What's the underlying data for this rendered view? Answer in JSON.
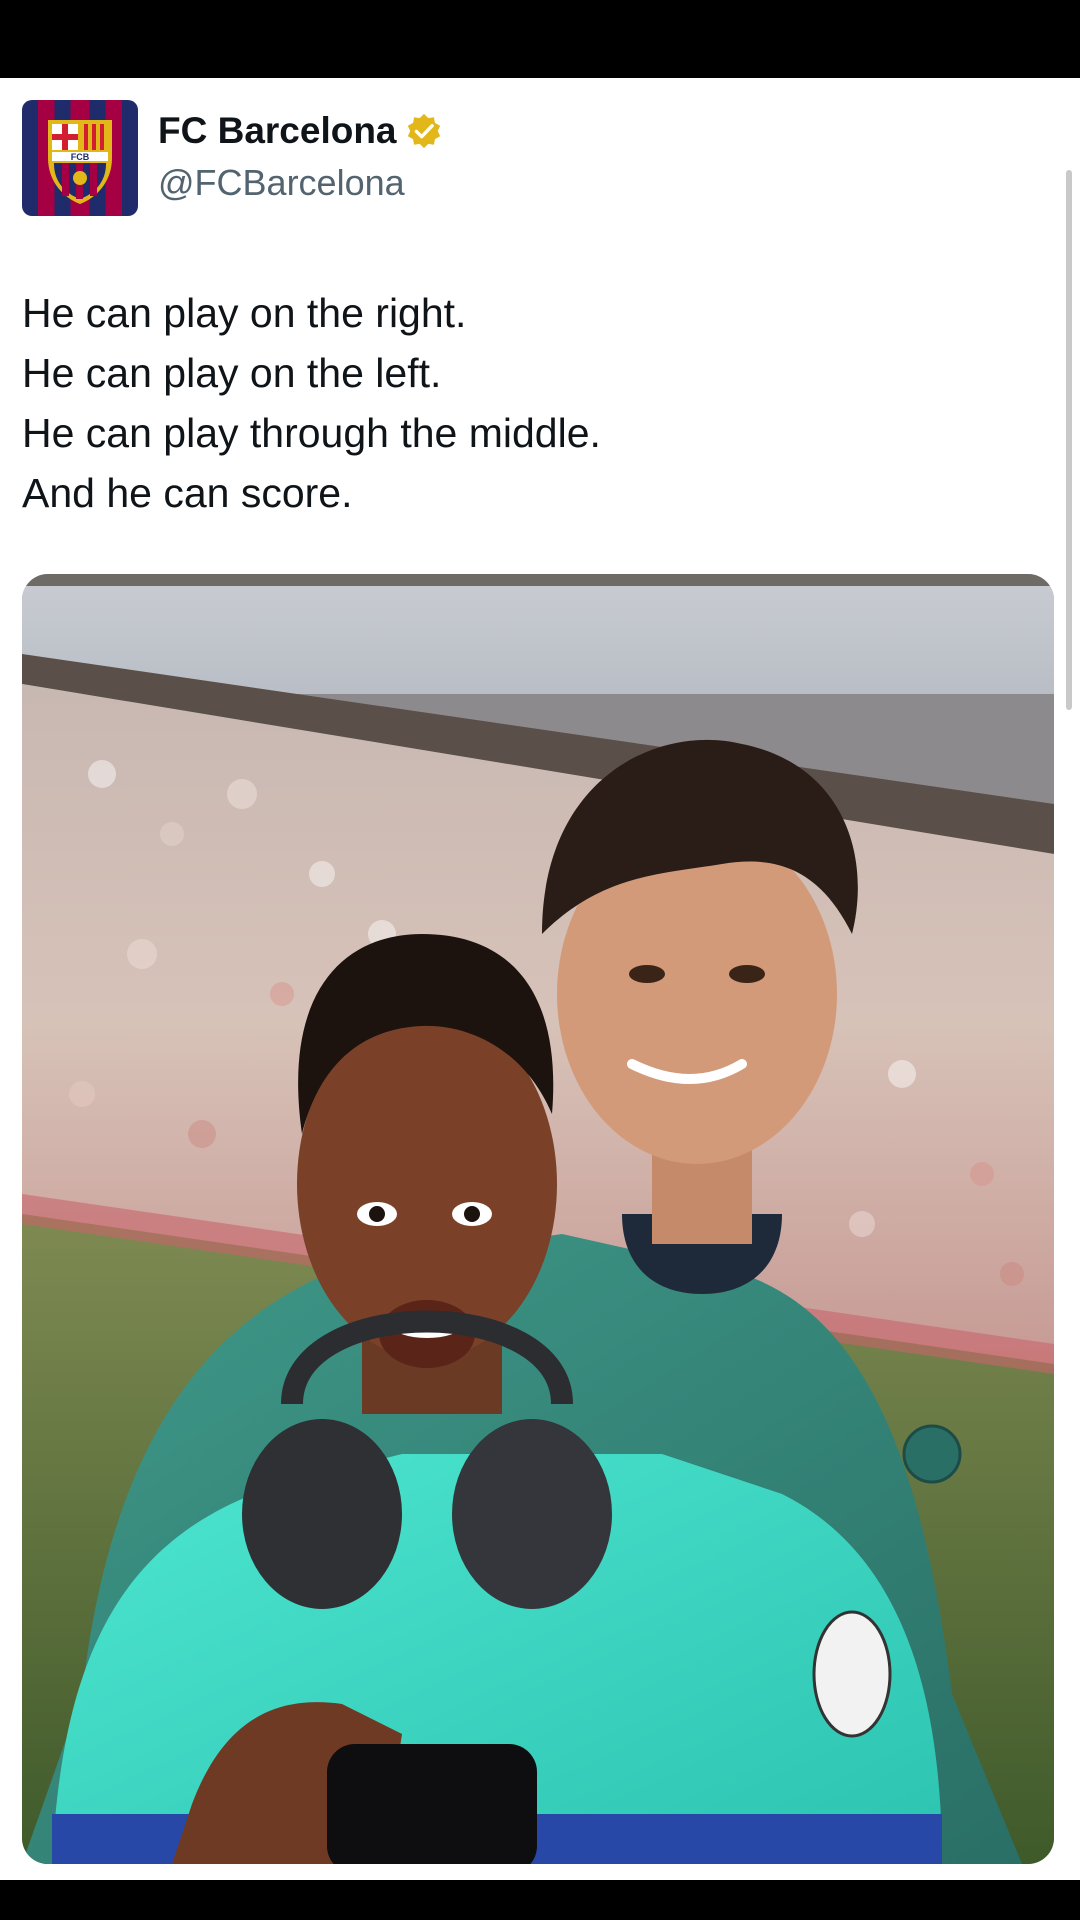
{
  "account": {
    "display_name": "FC Barcelona",
    "handle": "@FCBarcelona",
    "verified": true,
    "verified_color": "#e2b719",
    "avatar_crest_text": "FCB"
  },
  "tweet": {
    "lines": [
      "He can play on the right.",
      "He can play on the left.",
      "He can play through the middle.",
      "And he can score."
    ]
  },
  "media": {
    "type": "photo",
    "icons": [
      "verified-badge-icon",
      "club-crest-logo"
    ]
  },
  "colors": {
    "text_primary": "#0f1419",
    "text_secondary": "#536471",
    "barca_blue": "#1f2b6b",
    "barca_red": "#a50044",
    "kit_teal": "#3ad8c4"
  }
}
